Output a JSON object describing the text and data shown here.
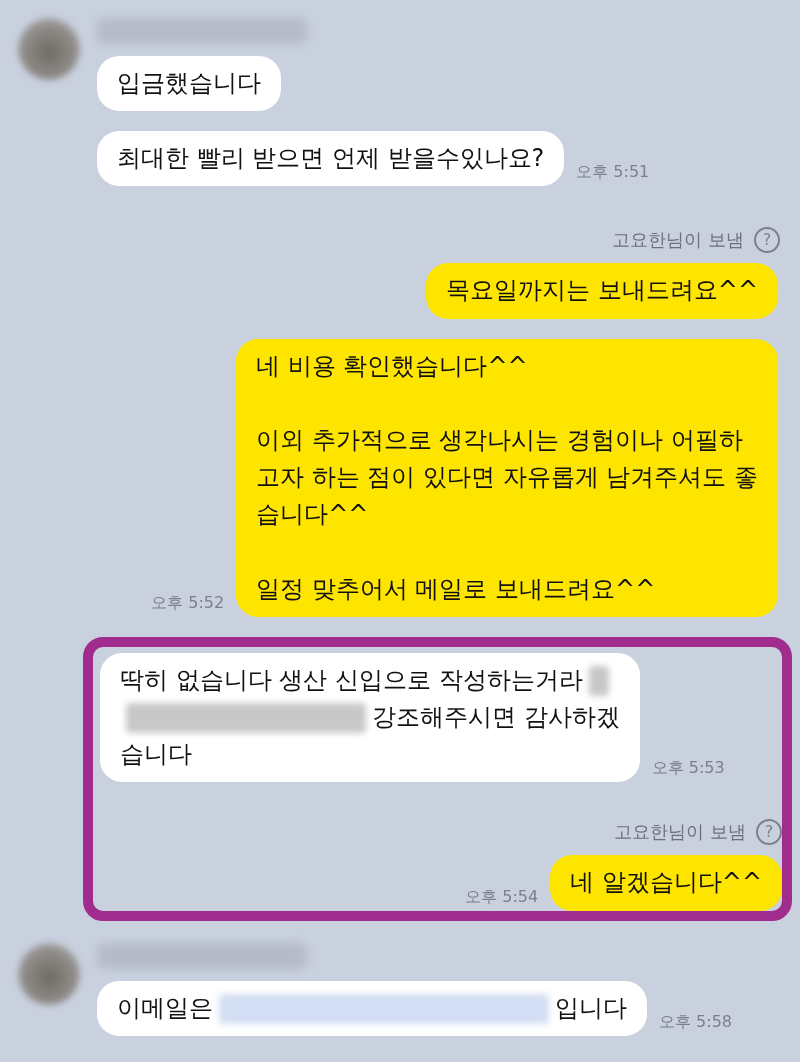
{
  "items": [
    {
      "kind": "group",
      "avatar": true,
      "messages": [
        {
          "lines": [
            [
              {
                "kind": "text",
                "text": "입금했습니다"
              }
            ]
          ]
        },
        {
          "lines": [
            [
              {
                "kind": "text",
                "text": "최대한 빨리 받으면 언제 받을수있나요?"
              }
            ]
          ],
          "time": "오후 5:51"
        }
      ]
    },
    {
      "kind": "note",
      "text": "고요한님이 보냄",
      "icon": "?"
    },
    {
      "kind": "sent",
      "paragraphs": [
        [
          "목요일까지는 보내드려요^^"
        ]
      ]
    },
    {
      "kind": "sent",
      "paragraphs": [
        [
          "네 비용 확인했습니다^^"
        ],
        [
          "이외 추가적으로 생각나시는 경험이나 어필하",
          "고자 하는 점이 있다면 자유롭게 남겨주셔도 좋",
          "습니다^^"
        ],
        [
          "일정 맞추어서 메일로 보내드려요^^"
        ]
      ],
      "time": "오후 5:52"
    },
    {
      "kind": "highlight",
      "color": "#a02c8e",
      "items": [
        {
          "kind": "group",
          "avatar": false,
          "messages": [
            {
              "lines": [
                [
                  {
                    "kind": "text",
                    "text": "딱히 없습니다 생산 신입으로 작성하는거라"
                  },
                  {
                    "kind": "redacted"
                  }
                ],
                [
                  {
                    "kind": "redacted"
                  },
                  {
                    "kind": "text",
                    "text": "강조해주시면 감사하겠"
                  }
                ],
                [
                  {
                    "kind": "text",
                    "text": "습니다"
                  }
                ]
              ],
              "time": "오후 5:53"
            }
          ]
        },
        {
          "kind": "note",
          "text": "고요한님이 보냄",
          "icon": "?"
        },
        {
          "kind": "sent",
          "paragraphs": [
            [
              "네 알겠습니다^^"
            ]
          ],
          "time": "오후 5:54"
        }
      ]
    },
    {
      "kind": "group",
      "avatar": true,
      "messages": [
        {
          "lines": [
            [
              {
                "kind": "text",
                "text": "이메일은"
              },
              {
                "kind": "redacted-link"
              },
              {
                "kind": "text",
                "text": "입니다"
              }
            ]
          ],
          "time": "오후 5:58"
        }
      ]
    }
  ]
}
